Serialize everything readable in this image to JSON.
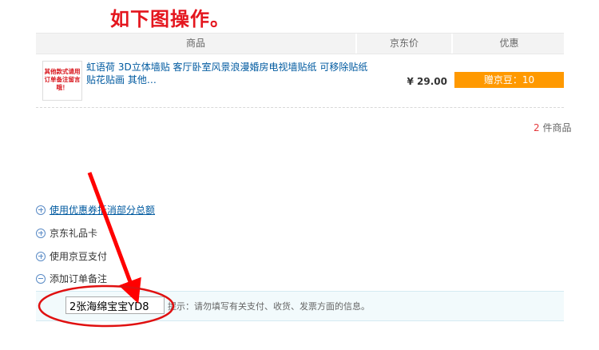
{
  "headline": "如下图操作。",
  "table": {
    "col_product": "商品",
    "col_price": "京东价",
    "col_promo": "优惠"
  },
  "product": {
    "thumb_text": "其他款式请用订单备注留言哦！",
    "name": "虹语荷 3D立体墙贴 客厅卧室风景浪漫婚房电视墙贴纸 可移除贴纸贴花贴画 其他…",
    "price": "¥ 29.00",
    "promo": "赠京豆：10"
  },
  "summary": {
    "count": "2",
    "count_suffix": "件商品"
  },
  "options": {
    "coupon": "使用优惠券抵消部分总额",
    "giftcard": "京东礼品卡",
    "jingdou": "使用京豆支付",
    "note": "添加订单备注"
  },
  "note": {
    "value": "2张海绵宝宝YD8",
    "hint": "提示：请勿填写有关支付、收货、发票方面的信息。"
  },
  "colors": {
    "accent_red": "#e4161e",
    "promo_orange": "#ff9900",
    "link_blue": "#005aa0"
  }
}
